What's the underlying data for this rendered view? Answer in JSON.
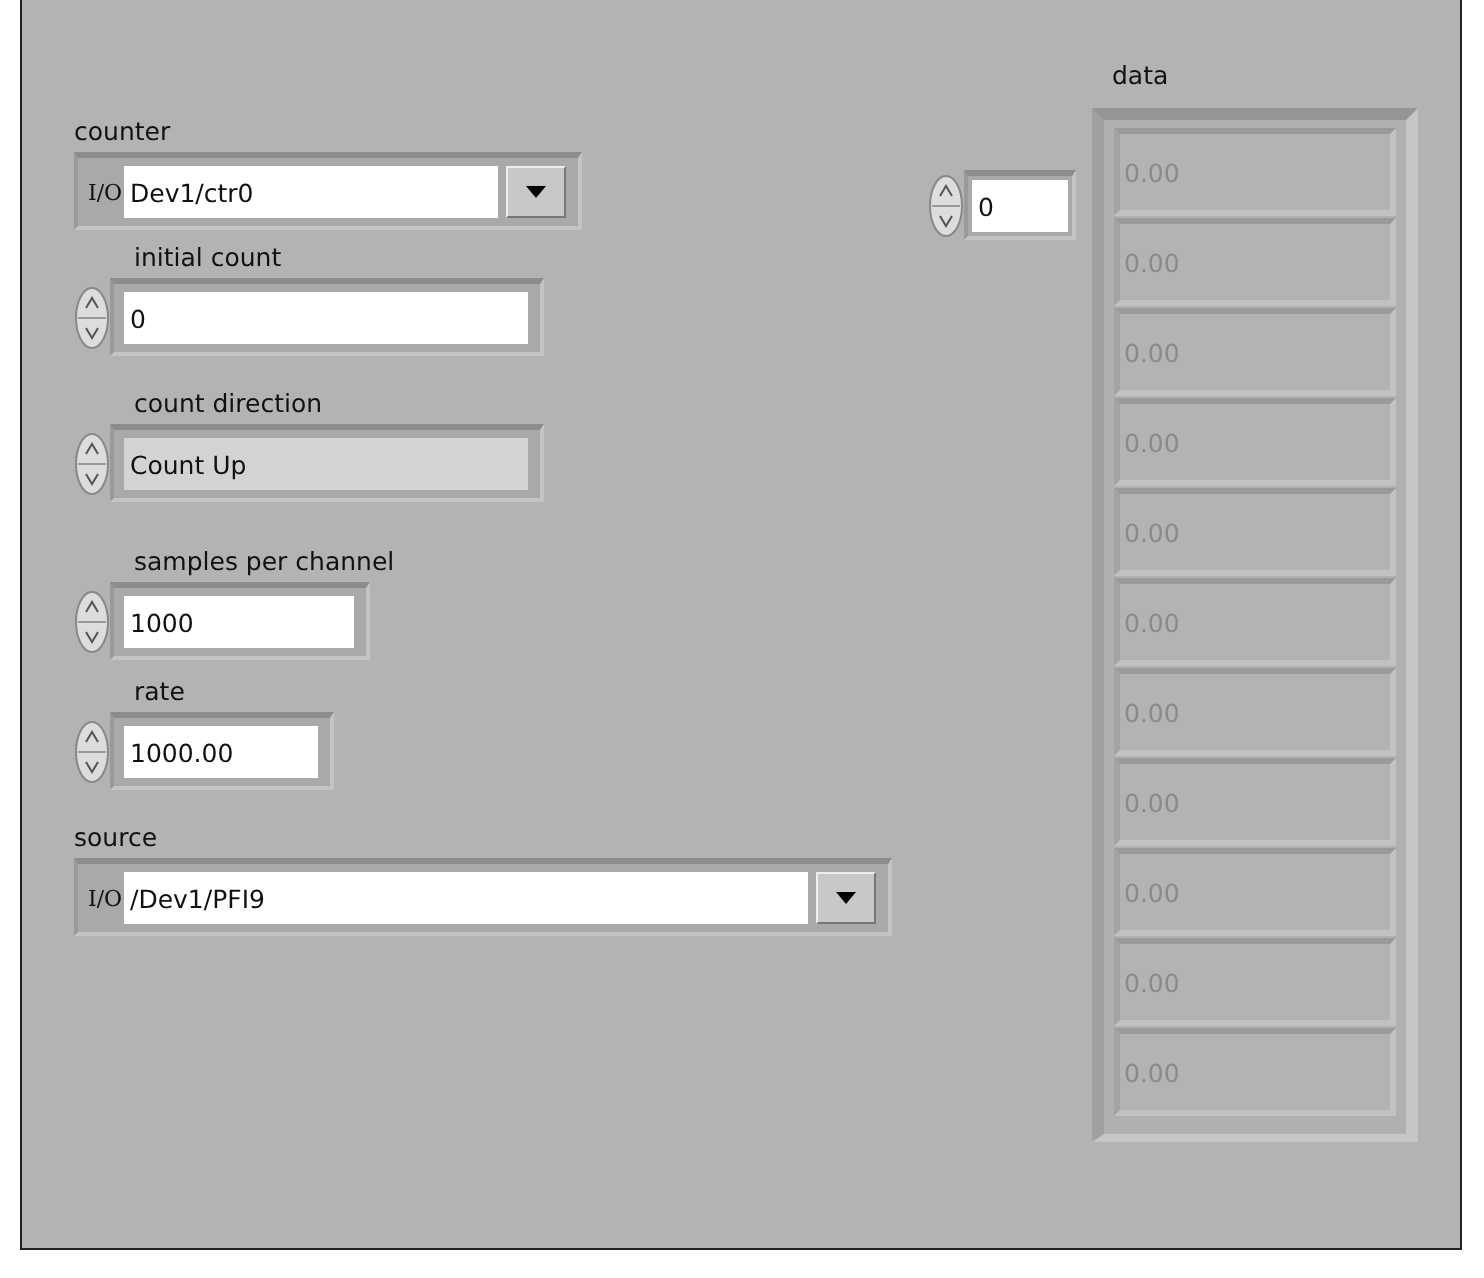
{
  "counter": {
    "label": "counter",
    "io_prefix": "I/O",
    "value": "Dev1/ctr0"
  },
  "initial_count": {
    "label": "initial count",
    "value": "0"
  },
  "count_direction": {
    "label": "count direction",
    "value": "Count Up"
  },
  "samples_per_channel": {
    "label": "samples per channel",
    "value": "1000"
  },
  "rate": {
    "label": "rate",
    "value": "1000.00"
  },
  "source": {
    "label": "source",
    "io_prefix": "I/O",
    "value": "/Dev1/PFI9"
  },
  "data": {
    "label": "data",
    "index": "0",
    "disabled": true,
    "elements": [
      "0.00",
      "0.00",
      "0.00",
      "0.00",
      "0.00",
      "0.00",
      "0.00",
      "0.00",
      "0.00",
      "0.00",
      "0.00"
    ]
  }
}
